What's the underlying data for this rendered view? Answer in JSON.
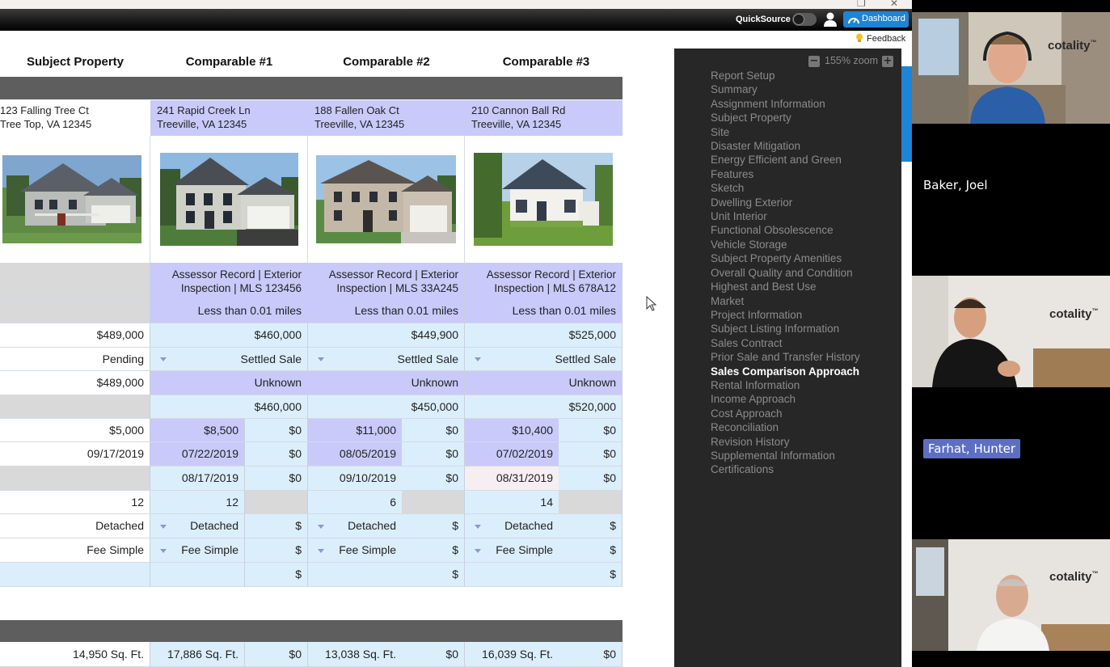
{
  "window": {
    "restore_glyph": "❐",
    "close_glyph": "✕"
  },
  "topbar": {
    "quicksource_label": "QuickSource",
    "dashboard_label": "Dashboard"
  },
  "feedback_label": "Feedback",
  "columns": [
    "Subject Property",
    "Comparable #1",
    "Comparable #2",
    "Comparable #3"
  ],
  "addresses": [
    [
      "123 Falling Tree Ct",
      "Tree Top, VA 12345"
    ],
    [
      "241 Rapid Creek Ln",
      "Treeville, VA 12345"
    ],
    [
      "188 Fallen Oak Ct",
      "Treeville, VA 12345"
    ],
    [
      "210 Cannon Ball Rd",
      "Treeville, VA 12345"
    ]
  ],
  "sources": [
    [
      "Assessor Record | Exterior",
      "Inspection | MLS 123456"
    ],
    [
      "Assessor Record | Exterior",
      "Inspection | MLS 33A245"
    ],
    [
      "Assessor Record | Exterior",
      "Inspection | MLS 678A12"
    ]
  ],
  "proximity": [
    "Less than 0.01 miles",
    "Less than 0.01 miles",
    "Less than 0.01 miles"
  ],
  "list_price": [
    "$489,000",
    "$460,000",
    "$449,900",
    "$525,000"
  ],
  "status": [
    "Pending",
    "Settled Sale",
    "Settled Sale",
    "Settled Sale"
  ],
  "contract_price": [
    "$489,000",
    "Unknown",
    "Unknown",
    "Unknown"
  ],
  "sale_price": [
    "$460,000",
    "$450,000",
    "$520,000"
  ],
  "concessions": {
    "subject": "$5,000",
    "comps": [
      "$8,500",
      "$11,000",
      "$10,400"
    ],
    "adj": [
      "$0",
      "$0",
      "$0"
    ]
  },
  "contract_date": {
    "subject": "09/17/2019",
    "comps": [
      "07/22/2019",
      "08/05/2019",
      "07/02/2019"
    ],
    "adj": [
      "$0",
      "$0",
      "$0"
    ]
  },
  "sale_date": {
    "comps": [
      "08/17/2019",
      "09/10/2019",
      "08/31/2019"
    ],
    "adj": [
      "$0",
      "$0",
      "$0"
    ]
  },
  "dom": {
    "subject": "12",
    "comps": [
      "12",
      "6",
      "14"
    ]
  },
  "attachment": {
    "subject": "Detached",
    "comps": [
      "Detached",
      "Detached",
      "Detached"
    ],
    "adj": [
      "$",
      "$",
      "$"
    ]
  },
  "ownership": {
    "subject": "Fee Simple",
    "comps": [
      "Fee Simple",
      "Fee Simple",
      "Fee Simple"
    ],
    "adj": [
      "$",
      "$",
      "$"
    ]
  },
  "other": {
    "adj": [
      "$",
      "$",
      "$"
    ]
  },
  "site_size": {
    "subject": "14,950 Sq. Ft.",
    "comps": [
      "17,886 Sq. Ft.",
      "13,038 Sq. Ft.",
      "16,039 Sq. Ft."
    ],
    "adj": [
      "$0",
      "$0",
      "$0"
    ]
  },
  "sidebar": {
    "zoom_label": "155% zoom",
    "zoom_minus": "−",
    "zoom_plus": "+",
    "items": [
      "Report Setup",
      "Summary",
      "Assignment Information",
      "Subject Property",
      "Site",
      "Disaster Mitigation",
      "Energy Efficient and Green",
      "Features",
      "Sketch",
      "Dwelling Exterior",
      "Unit Interior",
      "Functional Obsolescence",
      "Vehicle Storage",
      "Subject Property Amenities",
      "Overall Quality and Condition",
      "Highest and Best Use",
      "Market",
      "Project Information",
      "Subject Listing Information",
      "Sales Contract",
      "Prior Sale and Transfer History",
      "Sales Comparison Approach",
      "Rental Information",
      "Income Approach",
      "Cost Approach",
      "Reconciliation",
      "Revision History",
      "Supplemental Information",
      "Certifications"
    ],
    "active_index": 21
  },
  "video": {
    "participants": [
      "Baker, Joel",
      "Farhat, Hunter"
    ],
    "logo_text": "cotality",
    "logo_tm": "™"
  },
  "colors": {
    "accent": "#1e84d6",
    "purple_cell": "#c9caf9",
    "blue_cell": "#dbeefb",
    "header_bar": "#5e5e5e",
    "sidebar_bg": "#272727"
  }
}
